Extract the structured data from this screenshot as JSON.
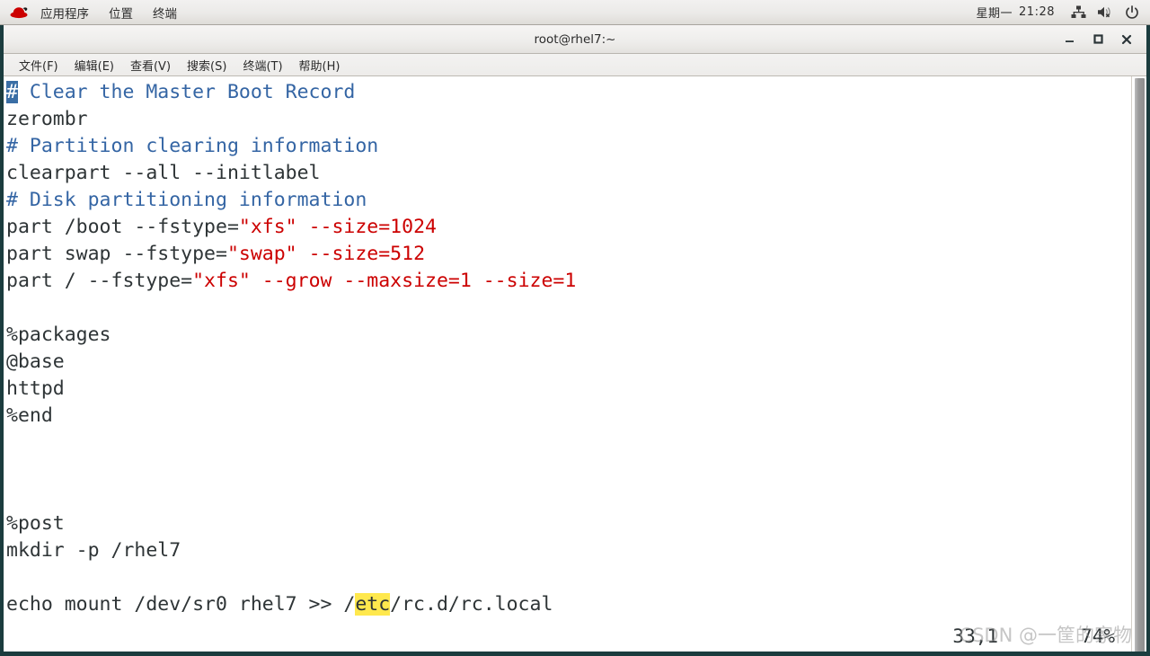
{
  "panel": {
    "logo_name": "red-hat-logo",
    "menus": [
      {
        "label": "应用程序"
      },
      {
        "label": "位置"
      },
      {
        "label": "终端"
      }
    ],
    "tray": {
      "day": "星期一",
      "time": "21:28",
      "icons": [
        {
          "name": "network-icon"
        },
        {
          "name": "volume-muted-icon"
        },
        {
          "name": "power-icon"
        }
      ]
    }
  },
  "window": {
    "title": "root@rhel7:~",
    "buttons": {
      "minimize": "minimize-button",
      "maximize": "maximize-button",
      "close": "close-button"
    }
  },
  "menubar": {
    "items": [
      {
        "label": "文件(F)"
      },
      {
        "label": "编辑(E)"
      },
      {
        "label": "查看(V)"
      },
      {
        "label": "搜索(S)"
      },
      {
        "label": "终端(T)"
      },
      {
        "label": "帮助(H)"
      }
    ]
  },
  "editor": {
    "lines": [
      {
        "segments": [
          {
            "t": "#",
            "c": "cmt cursor"
          },
          {
            "t": " Clear the Master Boot Record",
            "c": "cmt"
          }
        ]
      },
      {
        "segments": [
          {
            "t": "zerombr",
            "c": "plain"
          }
        ]
      },
      {
        "segments": [
          {
            "t": "# Partition clearing information",
            "c": "cmt"
          }
        ]
      },
      {
        "segments": [
          {
            "t": "clearpart --all --initlabel",
            "c": "plain"
          }
        ]
      },
      {
        "segments": [
          {
            "t": "# Disk partitioning information",
            "c": "cmt"
          }
        ]
      },
      {
        "segments": [
          {
            "t": "part /boot --fstype=",
            "c": "plain"
          },
          {
            "t": "\"xfs\"",
            "c": "str"
          },
          {
            "t": " ",
            "c": "plain"
          },
          {
            "t": "--size=1024",
            "c": "str"
          }
        ]
      },
      {
        "segments": [
          {
            "t": "part swap --fstype=",
            "c": "plain"
          },
          {
            "t": "\"swap\"",
            "c": "str"
          },
          {
            "t": " ",
            "c": "plain"
          },
          {
            "t": "--size=512",
            "c": "str"
          }
        ]
      },
      {
        "segments": [
          {
            "t": "part / --fstype=",
            "c": "plain"
          },
          {
            "t": "\"xfs\"",
            "c": "str"
          },
          {
            "t": " ",
            "c": "plain"
          },
          {
            "t": "--grow --maxsize=1 --size=1",
            "c": "str"
          }
        ]
      },
      {
        "segments": [
          {
            "t": "",
            "c": "plain"
          }
        ]
      },
      {
        "segments": [
          {
            "t": "%packages",
            "c": "plain"
          }
        ]
      },
      {
        "segments": [
          {
            "t": "@base",
            "c": "plain"
          }
        ]
      },
      {
        "segments": [
          {
            "t": "httpd",
            "c": "plain"
          }
        ]
      },
      {
        "segments": [
          {
            "t": "%end",
            "c": "plain"
          }
        ]
      },
      {
        "segments": [
          {
            "t": "",
            "c": "plain"
          }
        ]
      },
      {
        "segments": [
          {
            "t": "",
            "c": "plain"
          }
        ]
      },
      {
        "segments": [
          {
            "t": "",
            "c": "plain"
          }
        ]
      },
      {
        "segments": [
          {
            "t": "%post",
            "c": "plain"
          }
        ]
      },
      {
        "segments": [
          {
            "t": "mkdir -p /rhel7",
            "c": "plain"
          }
        ]
      },
      {
        "segments": [
          {
            "t": "",
            "c": "plain"
          }
        ]
      },
      {
        "segments": [
          {
            "t": "echo mount /dev/sr0 rhel7 >> /",
            "c": "plain"
          },
          {
            "t": "etc",
            "c": "plain hl-search"
          },
          {
            "t": "/rc.d/rc.local",
            "c": "plain"
          }
        ]
      }
    ]
  },
  "status": {
    "position": "33,1",
    "percent": "74%"
  },
  "watermark": {
    "text": "CSDN @一筐的家物"
  },
  "colors": {
    "comment_blue": "#3465a4",
    "string_red": "#cc0000",
    "text_dark": "#2e3436",
    "cursor_blue": "#3a6ea5",
    "search_yellow": "#ffe84d",
    "window_frame": "#1b3c3e"
  }
}
